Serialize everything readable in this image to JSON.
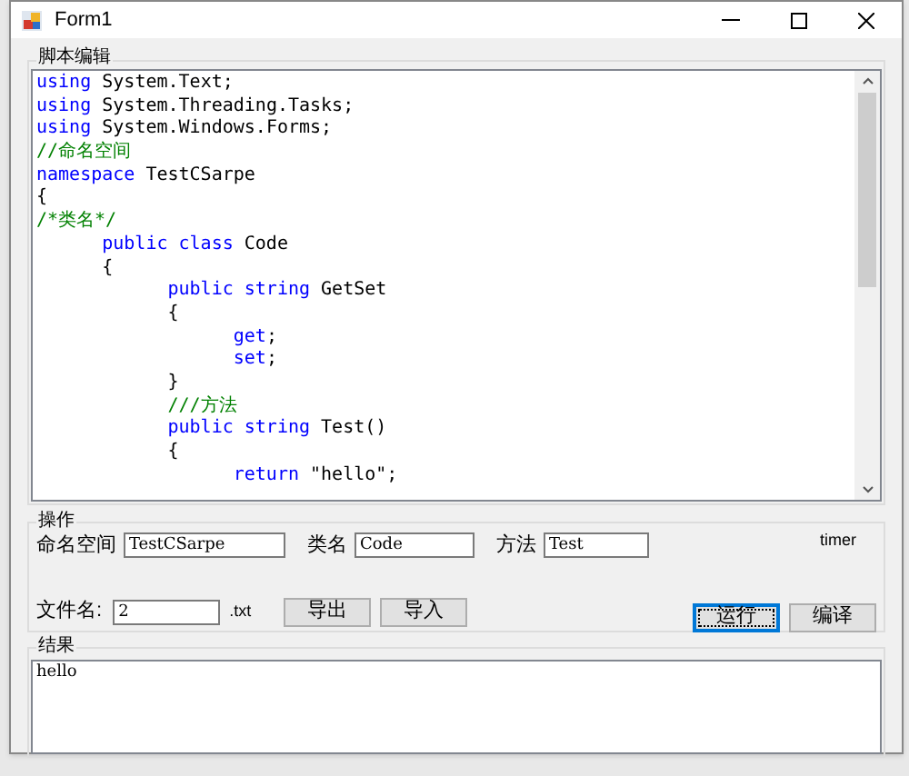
{
  "window": {
    "title": "Form1"
  },
  "editor": {
    "title": "脚本编辑",
    "lines": [
      {
        "tokens": [
          {
            "kind": "keyword",
            "text": "using"
          },
          {
            "kind": "plain",
            "text": " System.Text;"
          }
        ]
      },
      {
        "tokens": [
          {
            "kind": "keyword",
            "text": "using"
          },
          {
            "kind": "plain",
            "text": " System.Threading.Tasks;"
          }
        ]
      },
      {
        "tokens": [
          {
            "kind": "keyword",
            "text": "using"
          },
          {
            "kind": "plain",
            "text": " System.Windows.Forms;"
          }
        ]
      },
      {
        "tokens": [
          {
            "kind": "comment",
            "text": "//命名空间"
          }
        ]
      },
      {
        "tokens": [
          {
            "kind": "keyword",
            "text": "namespace"
          },
          {
            "kind": "plain",
            "text": " TestCSarpe"
          }
        ]
      },
      {
        "tokens": [
          {
            "kind": "plain",
            "text": "{"
          }
        ]
      },
      {
        "tokens": [
          {
            "kind": "comment",
            "text": "/*类名*/"
          }
        ]
      },
      {
        "tokens": [
          {
            "kind": "keyword",
            "text": "      public class"
          },
          {
            "kind": "plain",
            "text": " Code"
          }
        ]
      },
      {
        "tokens": [
          {
            "kind": "plain",
            "text": "      {"
          }
        ]
      },
      {
        "tokens": [
          {
            "kind": "keyword",
            "text": "            public string"
          },
          {
            "kind": "plain",
            "text": " GetSet"
          }
        ]
      },
      {
        "tokens": [
          {
            "kind": "plain",
            "text": "            {"
          }
        ]
      },
      {
        "tokens": [
          {
            "kind": "keyword",
            "text": "                  get"
          },
          {
            "kind": "plain",
            "text": ";"
          }
        ]
      },
      {
        "tokens": [
          {
            "kind": "keyword",
            "text": "                  set"
          },
          {
            "kind": "plain",
            "text": ";"
          }
        ]
      },
      {
        "tokens": [
          {
            "kind": "plain",
            "text": "            }"
          }
        ]
      },
      {
        "tokens": [
          {
            "kind": "comment",
            "text": "            ///方法"
          }
        ]
      },
      {
        "tokens": [
          {
            "kind": "keyword",
            "text": "            public string"
          },
          {
            "kind": "plain",
            "text": " Test()"
          }
        ]
      },
      {
        "tokens": [
          {
            "kind": "plain",
            "text": "            {"
          }
        ]
      },
      {
        "tokens": [
          {
            "kind": "keyword",
            "text": "                  return"
          },
          {
            "kind": "plain",
            "text": " \"hello\";"
          }
        ]
      }
    ]
  },
  "operations": {
    "title": "操作",
    "fields": [
      {
        "label": "命名空间",
        "value": "TestCSarpe"
      },
      {
        "label": "类名",
        "value": "Code"
      },
      {
        "label": "方法",
        "value": "Test"
      }
    ],
    "timer_label": "timer",
    "file": {
      "label": "文件名:",
      "value": "2",
      "extension": ".txt"
    },
    "file_buttons": [
      {
        "label": "导出",
        "selected": false
      },
      {
        "label": "导入",
        "selected": false
      }
    ],
    "action_buttons": [
      {
        "label": "运行",
        "selected": true
      },
      {
        "label": "编译",
        "selected": false
      }
    ]
  },
  "result": {
    "title": "结果",
    "value": "hello"
  }
}
